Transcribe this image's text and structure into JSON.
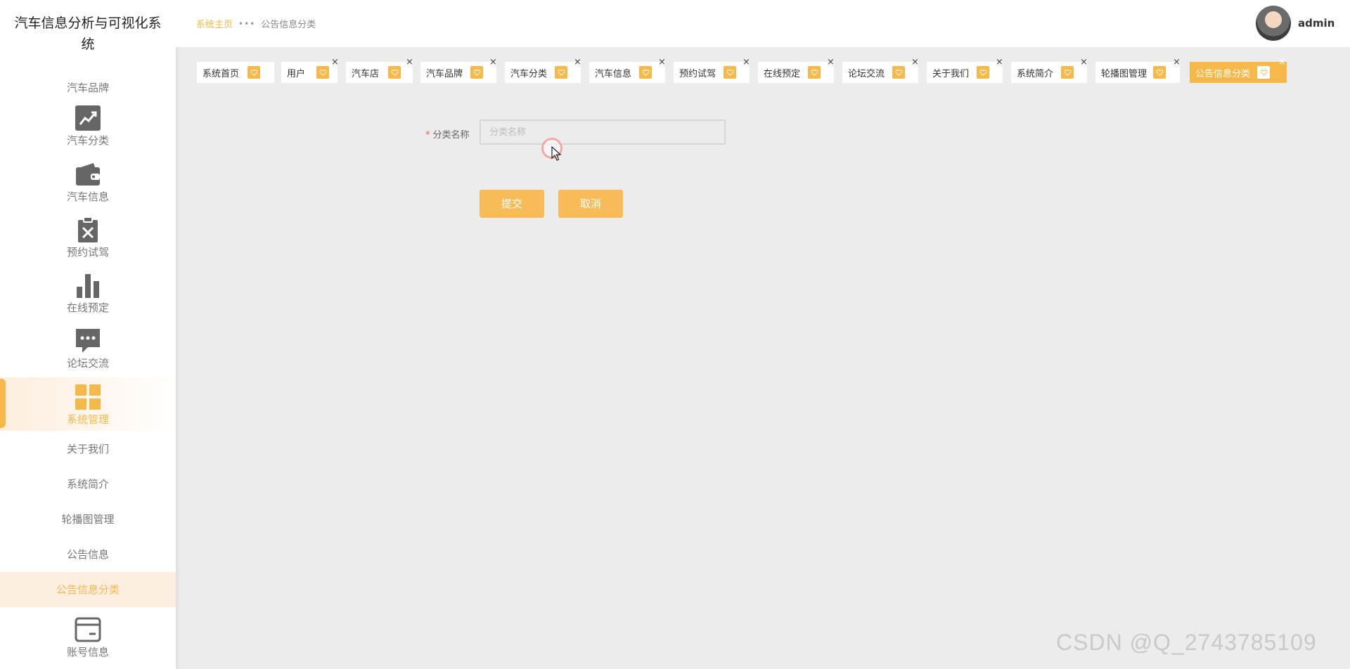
{
  "app": {
    "title": "汽车信息分析与可视化系统"
  },
  "sidebar": {
    "brand_item": "汽车品牌",
    "icon_items": [
      {
        "label": "汽车分类",
        "icon": "trend-chart-icon"
      },
      {
        "label": "汽车信息",
        "icon": "wallet-icon"
      },
      {
        "label": "预约试驾",
        "icon": "clipboard-x-icon"
      },
      {
        "label": "在线预定",
        "icon": "bar-chart-icon"
      },
      {
        "label": "论坛交流",
        "icon": "chat-bubble-icon"
      },
      {
        "label": "系统管理",
        "icon": "grid-icon",
        "active": true
      }
    ],
    "sub_items": [
      {
        "label": "关于我们"
      },
      {
        "label": "系统简介"
      },
      {
        "label": "轮播图管理"
      },
      {
        "label": "公告信息"
      },
      {
        "label": "公告信息分类",
        "active": true
      }
    ],
    "bottom_item": {
      "label": "账号信息",
      "icon": "card-icon"
    }
  },
  "header": {
    "breadcrumb_home": "系统主页",
    "breadcrumb_separator": "•••",
    "breadcrumb_current": "公告信息分类",
    "username": "admin"
  },
  "tabs": [
    {
      "label": "系统首页"
    },
    {
      "label": "用户"
    },
    {
      "label": "汽车店"
    },
    {
      "label": "汽车品牌"
    },
    {
      "label": "汽车分类"
    },
    {
      "label": "汽车信息"
    },
    {
      "label": "预约试驾"
    },
    {
      "label": "在线预定"
    },
    {
      "label": "论坛交流"
    },
    {
      "label": "关于我们"
    },
    {
      "label": "系统简介"
    },
    {
      "label": "轮播图管理"
    },
    {
      "label": "公告信息分类",
      "active": true
    }
  ],
  "form": {
    "required_mark": "*",
    "field_label": "分类名称",
    "field_placeholder": "分类名称",
    "submit_label": "提交",
    "cancel_label": "取消"
  },
  "watermark": "CSDN @Q_2743785109",
  "colors": {
    "accent": "#f7b84a",
    "background": "#ececec",
    "sidebar": "#ffffff"
  }
}
